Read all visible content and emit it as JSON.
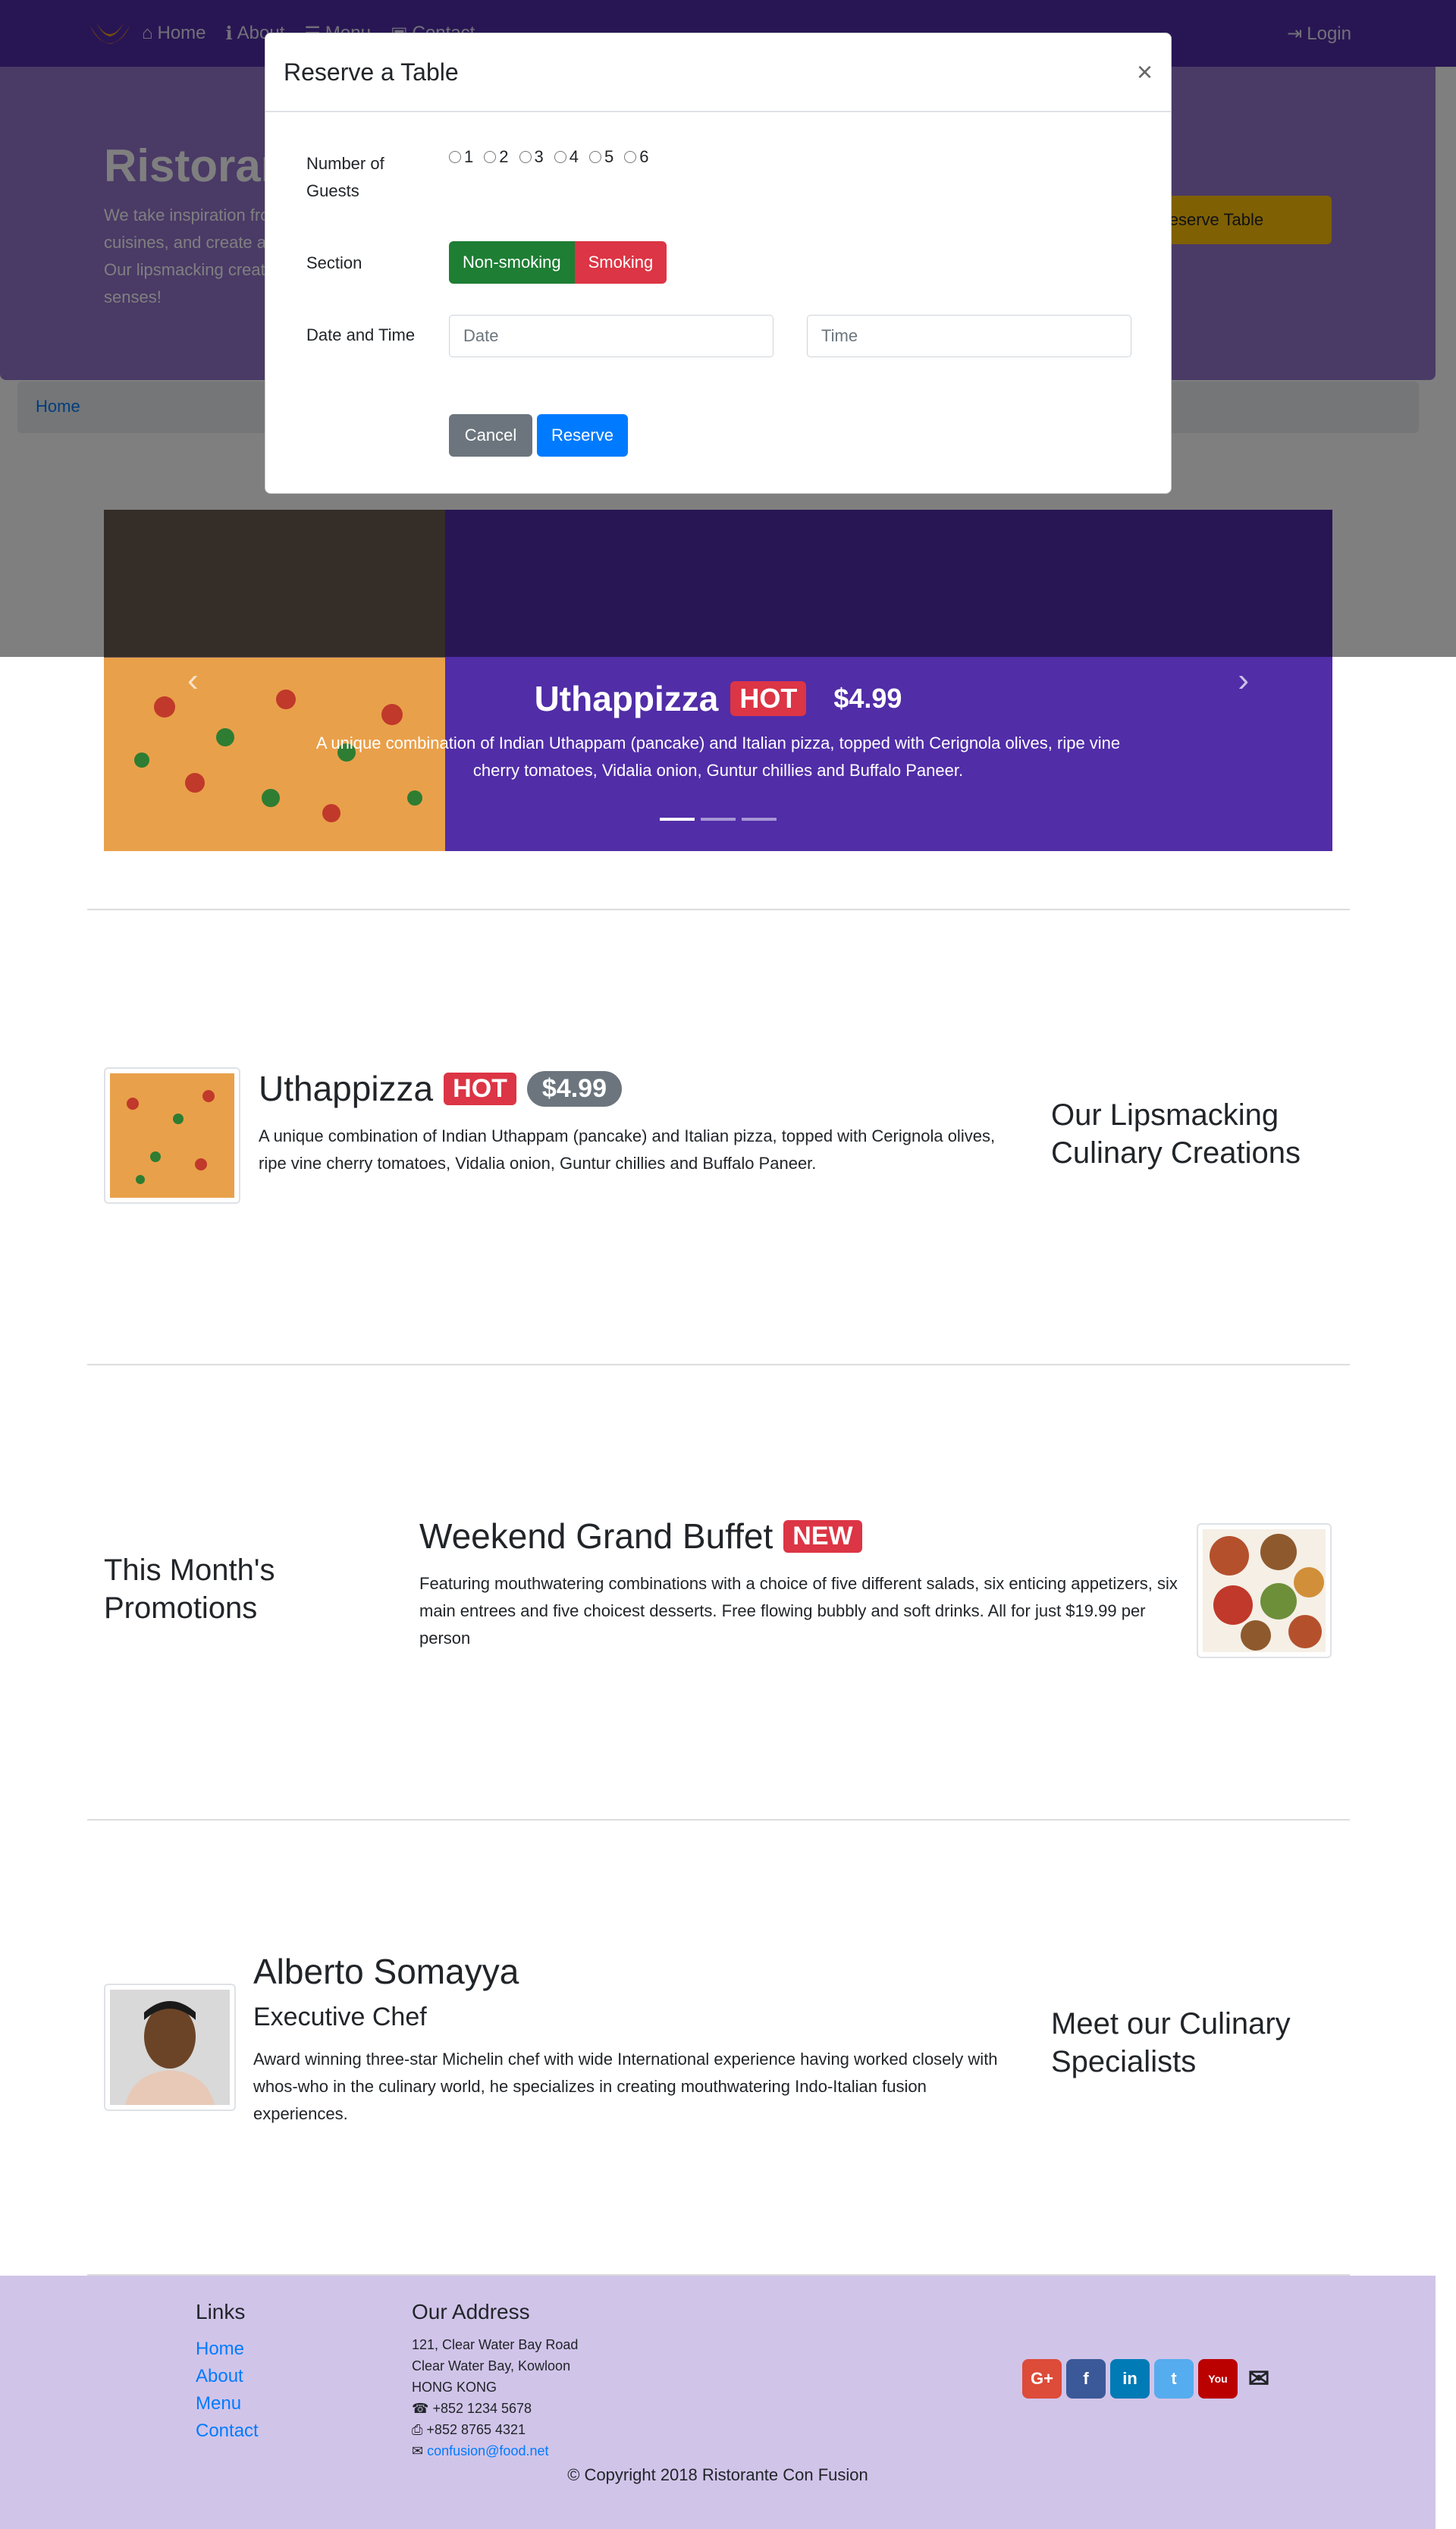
{
  "nav": {
    "items": [
      {
        "label": "Home",
        "icon": "home-icon"
      },
      {
        "label": "About",
        "icon": "info-icon"
      },
      {
        "label": "Menu",
        "icon": "list-icon"
      },
      {
        "label": "Contact",
        "icon": "address-card-icon"
      }
    ],
    "login": "Login"
  },
  "jumbotron": {
    "title": "Ristorante Con Fusion",
    "text": "We take inspiration from the World's best cuisines, and create a unique fusion experience. Our lipsmacking creations will tickle your culinary senses!",
    "button": "Reserve Table"
  },
  "breadcrumb": {
    "home": "Home"
  },
  "carousel": {
    "hidden_caption": "Alberto Somayya",
    "title": "Uthappizza",
    "badge": "HOT",
    "price": "$4.99",
    "description": "A unique combination of Indian Uthappam (pancake) and Italian pizza, topped with Cerignola olives, ripe vine cherry tomatoes, Vidalia onion, Guntur chillies and Buffalo Paneer.",
    "active_index": 0,
    "slides": 3
  },
  "dish": {
    "title": "Uthappizza",
    "badge": "HOT",
    "price": "$4.99",
    "description": "A unique combination of Indian Uthappam (pancake) and Italian pizza, topped with Cerignola olives, ripe vine cherry tomatoes, Vidalia onion, Guntur chillies and Buffalo Paneer.",
    "side_heading": "Our Lipsmacking Culinary Creations"
  },
  "promotion": {
    "side_heading": "This Month's Promotions",
    "title": "Weekend Grand Buffet",
    "badge": "NEW",
    "description": "Featuring mouthwatering combinations with a choice of five different salads, six enticing appetizers, six main entrees and five choicest desserts. Free flowing bubbly and soft drinks. All for just $19.99 per person"
  },
  "leader": {
    "name": "Alberto Somayya",
    "role": "Executive Chef",
    "description": "Award winning three-star Michelin chef with wide International experience having worked closely with whos-who in the culinary world, he specializes in creating mouthwatering Indo-Italian fusion experiences.",
    "side_heading": "Meet our Culinary Specialists"
  },
  "footer": {
    "links_heading": "Links",
    "links": [
      "Home",
      "About",
      "Menu",
      "Contact"
    ],
    "address_heading": "Our Address",
    "address": [
      "121, Clear Water Bay Road",
      "Clear Water Bay, Kowloon",
      "HONG KONG"
    ],
    "phone": "+852 1234 5678",
    "fax": "+852 8765 4321",
    "email": "confusion@food.net",
    "copyright": "© Copyright 2018 Ristorante Con Fusion"
  },
  "modal": {
    "title": "Reserve a Table",
    "close": "×",
    "guests_label": "Number of Guests",
    "guests_options": [
      "1",
      "2",
      "3",
      "4",
      "5",
      "6"
    ],
    "section_label": "Section",
    "section_options": [
      "Non-smoking",
      "Smoking"
    ],
    "datetime_label": "Date and Time",
    "date_placeholder": "Date",
    "time_placeholder": "Time",
    "cancel": "Cancel",
    "reserve": "Reserve"
  },
  "colors": {
    "primary": "#512DA8",
    "jumbotron": "#9575CD",
    "footer": "#D1C4E9",
    "reserve_button": "#FFC107"
  }
}
